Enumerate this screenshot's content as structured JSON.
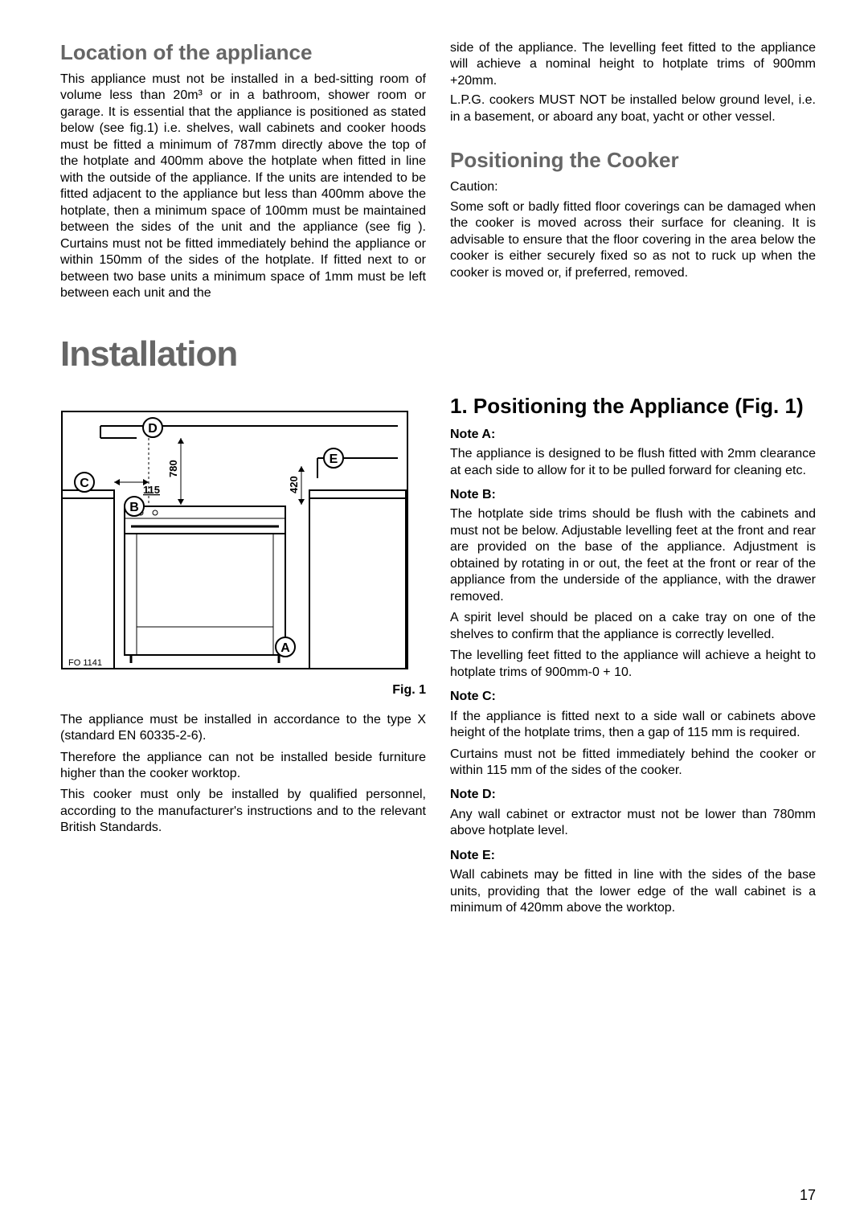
{
  "left_top": {
    "heading": "Location of the appliance",
    "body": "This appliance must not be installed in a bed-sitting room of volume less than 20m³ or in a bathroom, shower room or garage.  It is essential that the appliance is positioned as stated below (see fig.1) i.e. shelves, wall cabinets and cooker hoods must be fitted a minimum of 787mm directly above the top of the hotplate and 400mm above the hotplate when fitted in line with the outside of the appliance.  If the units are intended to be fitted adjacent to the appliance but less than 400mm above the hotplate, then a minimum space of 100mm must be maintained between the sides of the unit and the appliance (see fig ).  Curtains must not be fitted immediately behind the appliance or within 150mm of the sides of the hotplate. If fitted next to or between two base units a minimum space of 1mm must be left between each unit and the"
  },
  "right_top": {
    "body1": "side of the appliance.  The levelling feet fitted to the appliance will achieve a nominal height to hotplate trims of 900mm  +20mm.",
    "body2": "L.P.G. cookers MUST NOT be installed below ground level, i.e. in a basement, or aboard any boat, yacht or other vessel.",
    "heading": "Positioning the Cooker",
    "caution": "Caution:",
    "body3": "Some soft or badly fitted floor coverings can be damaged when the cooker is moved across their surface for cleaning. It is advisable to ensure that the floor covering in the area below the cooker is either securely fixed so as not to ruck up when the cooker is moved or, if preferred, removed."
  },
  "main_heading": "Installation",
  "figure": {
    "label_d": "D",
    "label_c": "C",
    "label_b": "B",
    "label_a": "A",
    "label_e": "E",
    "dim_115": "115",
    "dim_780": "780",
    "dim_420": "420",
    "ref": "FO  1141",
    "caption": "Fig. 1"
  },
  "left_bottom": {
    "p1": "The appliance must be installed in accordance to the type X (standard EN 60335-2-6).",
    "p2": "Therefore the appliance can not be installed beside furniture higher than the cooker worktop.",
    "p3": "This cooker must only be installed by qualified personnel, according to the manufacturer's instructions and to the relevant British Standards."
  },
  "right_bottom": {
    "heading": "1. Positioning the Appliance (Fig. 1)",
    "note_a_h": "Note A:",
    "note_a": "The appliance is designed to be flush fitted with 2mm clearance at each side to allow for it to be pulled forward for cleaning etc.",
    "note_b_h": "Note B:",
    "note_b1": "The hotplate side trims should be flush with the cabinets and must not be below. Adjustable levelling feet at the front and rear are provided on the base of the appliance. Adjustment is obtained by rotating in or out, the feet at the front or rear of the appliance from the underside of the appliance, with the drawer removed.",
    "note_b2": "A spirit level should be placed on a cake tray on one of the shelves to confirm that the appliance is correctly levelled.",
    "note_b3": "The levelling feet fitted to the appliance will achieve a height to hotplate trims of 900mm-0 + 10.",
    "note_c_h": "Note C:",
    "note_c1": "If the appliance is fitted next to a side wall or cabinets above height of the hotplate trims, then a gap of 115 mm is required.",
    "note_c2": "Curtains must not be fitted immediately behind the cooker or within 115 mm of the sides of the cooker.",
    "note_d_h": "Note D:",
    "note_d": "Any wall cabinet or extractor must not be lower than 780mm above hotplate level.",
    "note_e_h": "Note E:",
    "note_e": "Wall cabinets may be fitted in line with the sides of the base units, providing that the lower edge of the wall cabinet is a minimum of 420mm above the worktop."
  },
  "page": "17"
}
